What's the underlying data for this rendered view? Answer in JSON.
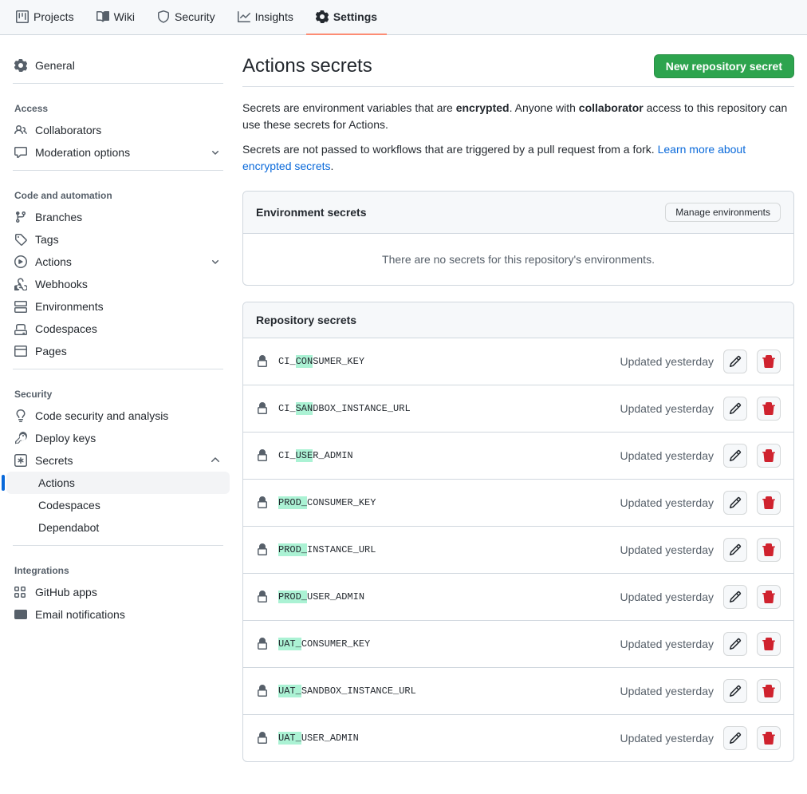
{
  "topnav": {
    "projects": "Projects",
    "wiki": "Wiki",
    "security": "Security",
    "insights": "Insights",
    "settings": "Settings"
  },
  "sidebar": {
    "general": "General",
    "access_header": "Access",
    "collaborators": "Collaborators",
    "moderation": "Moderation options",
    "code_header": "Code and automation",
    "branches": "Branches",
    "tags": "Tags",
    "actions": "Actions",
    "webhooks": "Webhooks",
    "environments": "Environments",
    "codespaces": "Codespaces",
    "pages": "Pages",
    "security_header": "Security",
    "code_security": "Code security and analysis",
    "deploy_keys": "Deploy keys",
    "secrets": "Secrets",
    "secrets_sub": {
      "actions": "Actions",
      "codespaces": "Codespaces",
      "dependabot": "Dependabot"
    },
    "integrations_header": "Integrations",
    "github_apps": "GitHub apps",
    "email_notifications": "Email notifications"
  },
  "page": {
    "title": "Actions secrets",
    "new_secret_btn": "New repository secret",
    "desc_prefix": "Secrets are environment variables that are ",
    "desc_encrypted": "encrypted",
    "desc_mid": ". Anyone with ",
    "desc_collaborator": "collaborator",
    "desc_suffix": " access to this repository can use these secrets for Actions.",
    "desc2_prefix": "Secrets are not passed to workflows that are triggered by a pull request from a fork. ",
    "desc2_link": "Learn more about encrypted secrets",
    "desc2_period": "."
  },
  "env_box": {
    "title": "Environment secrets",
    "manage_btn": "Manage environments",
    "empty": "There are no secrets for this repository's environments."
  },
  "repo_box": {
    "title": "Repository secrets",
    "updated_label": "Updated yesterday",
    "secrets": [
      {
        "prefix": "CI_",
        "hl": "CON",
        "rest": "SUMER_KEY"
      },
      {
        "prefix": "CI_",
        "hl": "SAN",
        "rest": "DBOX_INSTANCE_URL"
      },
      {
        "prefix": "CI_",
        "hl": "USE",
        "rest": "R_ADMIN"
      },
      {
        "prefix": "",
        "hl": "PROD_",
        "rest": "CONSUMER_KEY"
      },
      {
        "prefix": "",
        "hl": "PROD_",
        "rest": "INSTANCE_URL"
      },
      {
        "prefix": "",
        "hl": "PROD_",
        "rest": "USER_ADMIN"
      },
      {
        "prefix": "",
        "hl": "UAT_",
        "rest": "CONSUMER_KEY"
      },
      {
        "prefix": "",
        "hl": "UAT_",
        "rest": "SANDBOX_INSTANCE_URL"
      },
      {
        "prefix": "",
        "hl": "UAT_",
        "rest": "USER_ADMIN"
      }
    ]
  }
}
